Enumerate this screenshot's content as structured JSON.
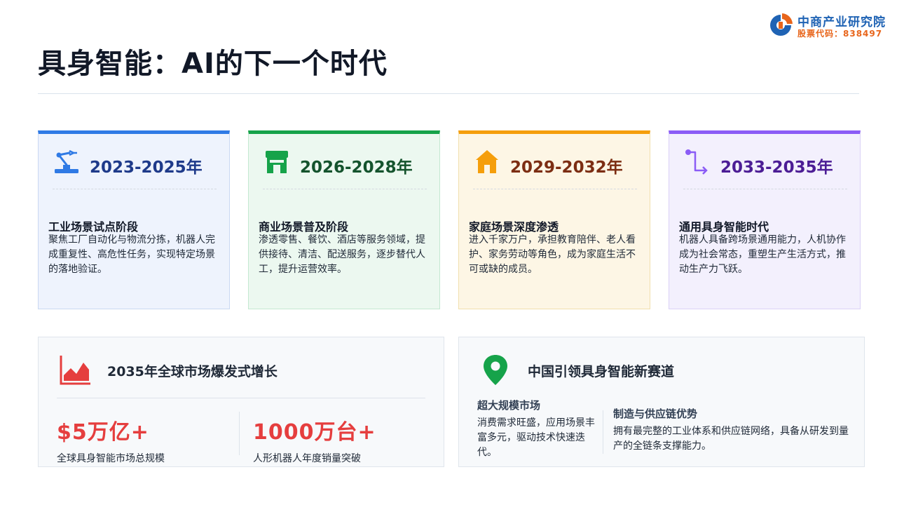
{
  "header": {
    "title": "具身智能：AI的下一个时代",
    "brand_name": "中商产业研究院",
    "brand_code": "股票代码：838497"
  },
  "timeline": [
    {
      "period": "2023-2025年",
      "title": "工业场景试点阶段",
      "desc": "聚焦工厂自动化与物流分拣，机器人完成重复性、高危性任务，实现特定场景的落地验证。",
      "icon": "robot-arm-icon",
      "accent": "#2f7ae5"
    },
    {
      "period": "2026-2028年",
      "title": "商业场景普及阶段",
      "desc": "渗透零售、餐饮、酒店等服务领域，提供接待、清洁、配送服务，逐步替代人工，提升运营效率。",
      "icon": "storefront-icon",
      "accent": "#16a34a"
    },
    {
      "period": "2029-2032年",
      "title": "家庭场景深度渗透",
      "desc": "进入千家万户，承担教育陪伴、老人看护、家务劳动等角色，成为家庭生活不可或缺的成员。",
      "icon": "house-icon",
      "accent": "#f59e0b"
    },
    {
      "period": "2033-2035年",
      "title": "通用具身智能时代",
      "desc": "机器人具备跨场景通用能力，人机协作成为社会常态，重塑生产生活方式，推动生产力飞跃。",
      "icon": "route-icon",
      "accent": "#8b5cf6"
    }
  ],
  "market_panel": {
    "title": "2035年全球市场爆发式增长",
    "icon": "area-chart-icon",
    "stats": [
      {
        "value": "$5万亿+",
        "label": "全球具身智能市场总规模"
      },
      {
        "value": "1000万台+",
        "label": "人形机器人年度销量突破"
      }
    ]
  },
  "china_panel": {
    "title": "中国引领具身智能新赛道",
    "icon": "map-pin-icon",
    "features": [
      {
        "title": "超大规模市场",
        "desc": "消费需求旺盛，应用场景丰富多元，驱动技术快速迭代。"
      },
      {
        "title": "制造与供应链优势",
        "desc": "拥有最完整的工业体系和供应链网络，具备从研发到量产的全链条支撑能力。"
      }
    ]
  },
  "colors": {
    "accent_red": "#e53e3e",
    "brand_blue": "#1f63b4",
    "brand_orange": "#e8651b",
    "pin_green": "#16a34a"
  }
}
